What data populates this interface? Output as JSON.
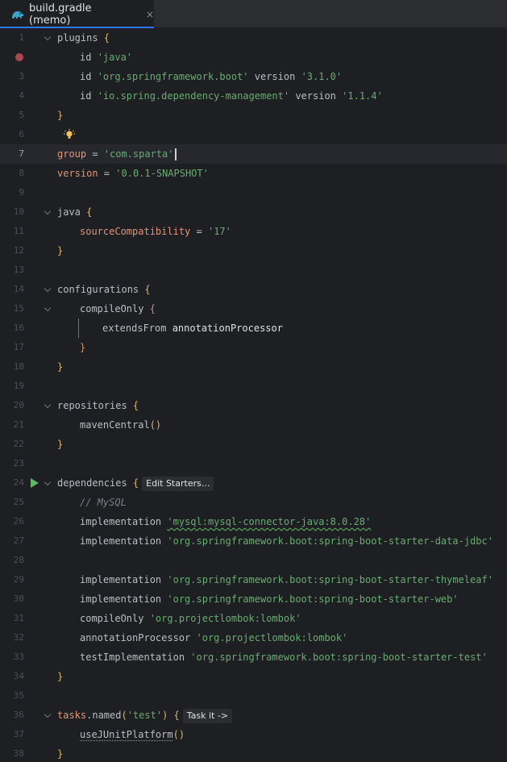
{
  "tab": {
    "title": "build.gradle (memo)",
    "close_glyph": "×",
    "icon": "gradle-elephant-icon"
  },
  "inlays": {
    "edit_starters": "Edit Starters...",
    "task_it": "Task it ->"
  },
  "lines": [
    "1",
    "2",
    "3",
    "4",
    "5",
    "6",
    "7",
    "8",
    "9",
    "10",
    "11",
    "12",
    "13",
    "14",
    "15",
    "16",
    "17",
    "18",
    "19",
    "20",
    "21",
    "22",
    "23",
    "24",
    "25",
    "26",
    "27",
    "28",
    "29",
    "30",
    "31",
    "32",
    "33",
    "34",
    "35",
    "36",
    "37",
    "38"
  ],
  "code": {
    "l1": {
      "kw": "plugins",
      "brace": " {"
    },
    "l2": {
      "a": "id ",
      "b": "'java'"
    },
    "l3": {
      "a": "id ",
      "b": "'org.springframework.boot'",
      "c": " version ",
      "d": "'3.1.0'"
    },
    "l4": {
      "a": "id ",
      "b": "'io.spring.dependency-management'",
      "c": " version ",
      "d": "'1.1.4'"
    },
    "l5": {
      "brace": "}"
    },
    "l7": {
      "a": "group",
      "b": " = ",
      "c": "'com.sparta'"
    },
    "l8": {
      "a": "version",
      "b": " = ",
      "c": "'0.0.1-SNAPSHOT'"
    },
    "l10": {
      "a": "java",
      "brace": " {"
    },
    "l11": {
      "a": "sourceCompatibility",
      "b": " = ",
      "c": "'17'"
    },
    "l12": {
      "brace": "}"
    },
    "l14": {
      "a": "configurations",
      "brace": " {"
    },
    "l15": {
      "a": "compileOnly",
      "brace": " {"
    },
    "l16": {
      "a": "extendsFrom ",
      "b": "annotationProcessor"
    },
    "l17": {
      "brace": "}"
    },
    "l18": {
      "brace": "}"
    },
    "l20": {
      "a": "repositories",
      "brace": " {"
    },
    "l21": {
      "a": "mavenCentral",
      "b": "()"
    },
    "l22": {
      "brace": "}"
    },
    "l24": {
      "a": "dependencies",
      "brace": " {"
    },
    "l25": {
      "cmt": "// MySQL"
    },
    "l26": {
      "a": "implementation ",
      "b": "'mysql:mysql-connector-java:8.0.28'"
    },
    "l27": {
      "a": "implementation ",
      "b": "'org.springframework.boot:spring-boot-starter-data-jdbc'"
    },
    "l29": {
      "a": "implementation ",
      "b": "'org.springframework.boot:spring-boot-starter-thymeleaf'"
    },
    "l30": {
      "a": "implementation ",
      "b": "'org.springframework.boot:spring-boot-starter-web'"
    },
    "l31": {
      "a": "compileOnly ",
      "b": "'org.projectlombok:lombok'"
    },
    "l32": {
      "a": "annotationProcessor ",
      "b": "'org.projectlombok:lombok'"
    },
    "l33": {
      "a": "testImplementation ",
      "b": "'org.springframework.boot:spring-boot-starter-test'"
    },
    "l34": {
      "brace": "}"
    },
    "l36": {
      "a": "tasks",
      "b": ".",
      "c": "named",
      "d": "(",
      "e": "'test'",
      "f": ")",
      "brace": " {"
    },
    "l37": {
      "a": "useJUnitPlatform",
      "b": "()"
    },
    "l38": {
      "brace": "}"
    }
  },
  "colors": {
    "background": "#1e1f22",
    "keyword": "#cf8e6d",
    "string": "#6aab73",
    "brace": "#d5b778",
    "accent": "#3574f0"
  }
}
